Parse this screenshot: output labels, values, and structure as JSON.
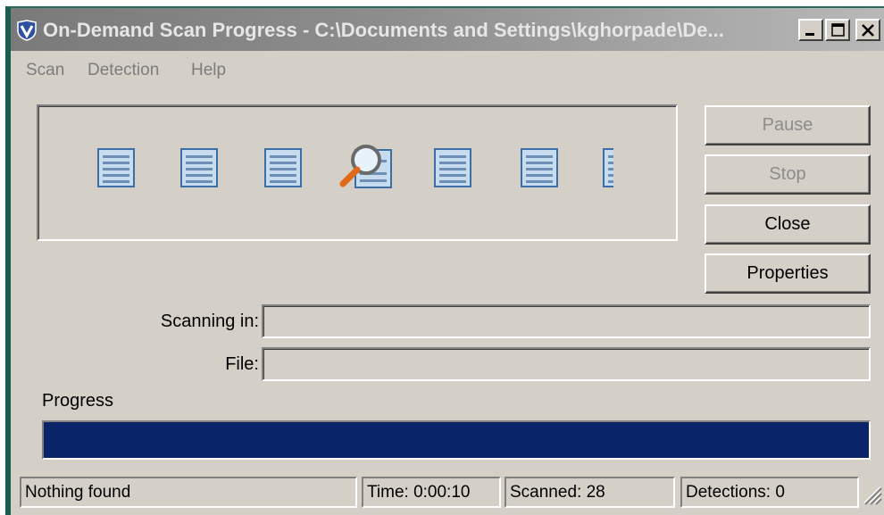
{
  "window": {
    "title": "On-Demand Scan Progress - C:\\Documents and Settings\\kghorpade\\De...",
    "app_icon": "mcafee-shield-icon"
  },
  "menu": {
    "items": [
      "Scan",
      "Detection",
      "Help"
    ]
  },
  "animation": {
    "document_icon": "document-icon",
    "magnifier_icon": "magnifier-icon"
  },
  "buttons": {
    "pause": "Pause",
    "stop": "Stop",
    "close": "Close",
    "properties": "Properties"
  },
  "fields": {
    "scanning_in_label": "Scanning in:",
    "scanning_in_value": "",
    "file_label": "File:",
    "file_value": ""
  },
  "progress": {
    "label": "Progress",
    "percent": 100,
    "color": "#0a246a"
  },
  "status": {
    "message": "Nothing found",
    "time": "Time: 0:00:10",
    "scanned": "Scanned: 28",
    "detections": "Detections: 0"
  },
  "colors": {
    "dialog_bg": "#d4d0c8",
    "titlebar_inactive": "#8e8e8e",
    "disabled_text": "#8c8c8c"
  }
}
